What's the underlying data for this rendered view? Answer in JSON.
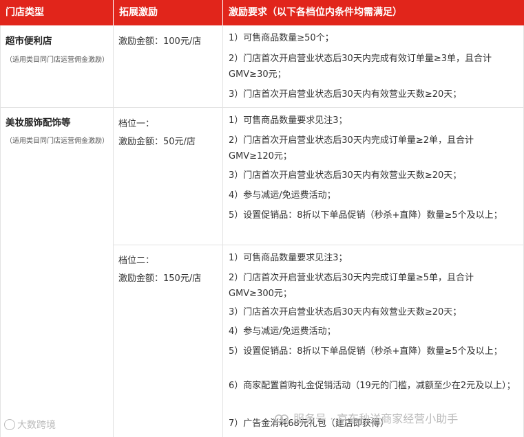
{
  "header": {
    "col1": "门店类型",
    "col2": "拓展激励",
    "col3": "激励要求（以下各档位内条件均需满足）"
  },
  "rows": {
    "supermarket": {
      "title": "超市便利店",
      "note": "（适用类目同门店运营佣金激励）",
      "incentive": "激励金额：100元/店",
      "reqs": [
        "1）可售商品数量≥50个；",
        "2）门店首次开启营业状态后30天内完成有效订单量≥3单，且合计GMV≥30元；",
        "3）门店首次开启营业状态后30天内有效营业天数≥20天；"
      ]
    },
    "beauty": {
      "title": "美妆服饰配饰等",
      "note": "（适用类目同门店运营佣金激励）",
      "tier1": {
        "name": "档位一：",
        "incentive": "激励金额：50元/店",
        "reqs": [
          "1）可售商品数量要求见注3；",
          "2）门店首次开启营业状态后30天内完成订单量≥2单，且合计GMV≥120元；",
          "3）门店首次开启营业状态后30天内有效营业天数≥20天；",
          "4）参与减运/免运费活动；",
          "5）设置促销品：8折以下单品促销（秒杀+直降）数量≥5个及以上；"
        ]
      },
      "tier2": {
        "name": "档位二：",
        "incentive": "激励金额：150元/店",
        "reqs": [
          "1）可售商品数量要求见注3；",
          "2）门店首次开启营业状态后30天内完成订单量≥5单，且合计GMV≥300元；",
          "3）门店首次开启营业状态后30天内有效营业天数≥20天；",
          "4）参与减运/免运费活动；",
          "5）设置促销品：8折以下单品促销（秒杀+直降）数量≥5个及以上；",
          "6）商家配置首购礼金促销活动（19元的门槛，减额至少在2元及以上）；",
          "7）广告金消耗68元礼包（建店即获得）"
        ]
      }
    }
  },
  "watermark": {
    "source": "服务号 · 京东秒送商家经营小助手",
    "logo": "大数跨境"
  }
}
